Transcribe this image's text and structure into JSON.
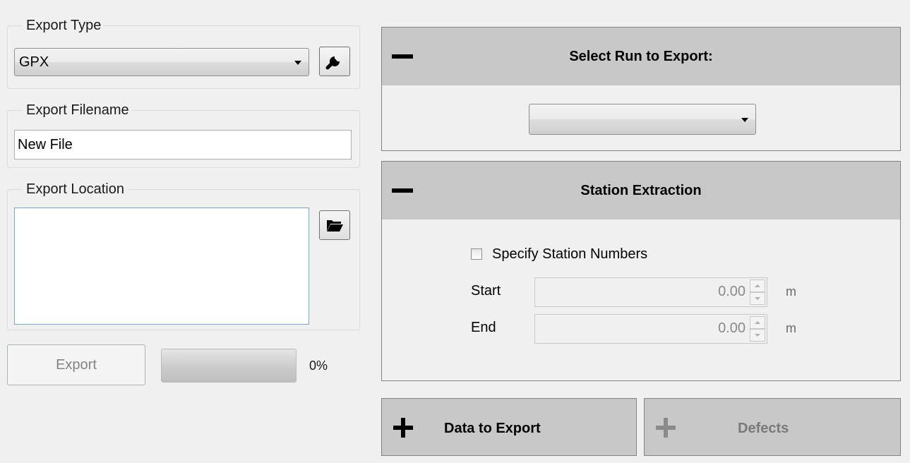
{
  "export_type": {
    "label": "Export Type",
    "selected": "GPX",
    "settings_icon": "wrench-icon"
  },
  "export_filename": {
    "label": "Export Filename",
    "value": "New File"
  },
  "export_location": {
    "label": "Export Location",
    "value": "",
    "browse_icon": "folder-open-icon"
  },
  "export_action": {
    "button_label": "Export",
    "progress_text": "0%",
    "progress_fraction": 0
  },
  "select_run": {
    "title": "Select Run to Export:",
    "selected": "",
    "collapse_icon": "minus-icon"
  },
  "station_extraction": {
    "title": "Station Extraction",
    "collapse_icon": "minus-icon",
    "checkbox_label": "Specify Station Numbers",
    "checked": false,
    "start_label": "Start",
    "start_value": "0.00",
    "end_label": "End",
    "end_value": "0.00",
    "unit": "m"
  },
  "data_to_export": {
    "label": "Data to Export",
    "expand_icon": "plus-icon"
  },
  "defects": {
    "label": "Defects",
    "expand_icon": "plus-icon"
  },
  "colors": {
    "panel_header": "#c8c8c8",
    "background": "#f0f0f0",
    "disabled_text": "#838383"
  }
}
